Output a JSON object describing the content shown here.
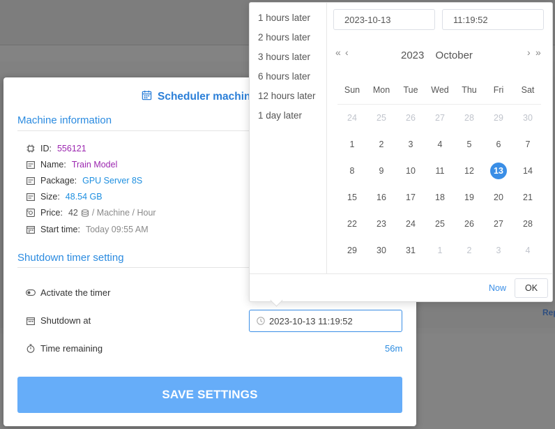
{
  "modal": {
    "title": "Scheduler machin",
    "machine_section": "Machine information",
    "machine": {
      "id_label": "ID:",
      "id_value": "556121",
      "name_label": "Name:",
      "name_value": "Train Model",
      "package_label": "Package:",
      "package_value": "GPU Server 8S",
      "size_label": "Size:",
      "size_value": "48.54 GB",
      "price_label": "Price:",
      "price_value": "42",
      "price_unit": "/ Machine / Hour",
      "start_label": "Start time:",
      "start_value": "Today 09:55 AM"
    },
    "timer_section": "Shutdown timer setting",
    "activate_label": "Activate the timer",
    "shutdown_label": "Shutdown at",
    "shutdown_value": "2023-10-13 11:19:52",
    "remaining_label": "Time remaining",
    "remaining_value": "56m",
    "save_label": "SAVE SETTINGS"
  },
  "background": {
    "link_text": "Rep"
  },
  "picker": {
    "shortcuts": [
      "1 hours later",
      "2 hours later",
      "3 hours later",
      "6 hours later",
      "12 hours later",
      "1 day later"
    ],
    "date_value": "2023-10-13",
    "time_value": "11:19:52",
    "year": "2023",
    "month": "October",
    "prev_year": "«",
    "prev_month": "‹",
    "next_month": "›",
    "next_year": "»",
    "weekdays": [
      "Sun",
      "Mon",
      "Tue",
      "Wed",
      "Thu",
      "Fri",
      "Sat"
    ],
    "weeks": [
      [
        "24",
        "25",
        "26",
        "27",
        "28",
        "29",
        "30"
      ],
      [
        "1",
        "2",
        "3",
        "4",
        "5",
        "6",
        "7"
      ],
      [
        "8",
        "9",
        "10",
        "11",
        "12",
        "13",
        "14"
      ],
      [
        "15",
        "16",
        "17",
        "18",
        "19",
        "20",
        "21"
      ],
      [
        "22",
        "23",
        "24",
        "25",
        "26",
        "27",
        "28"
      ],
      [
        "29",
        "30",
        "31",
        "1",
        "2",
        "3",
        "4"
      ]
    ],
    "other_month": [
      [
        true,
        true,
        true,
        true,
        true,
        true,
        true
      ],
      [
        false,
        false,
        false,
        false,
        false,
        false,
        false
      ],
      [
        false,
        false,
        false,
        false,
        false,
        false,
        false
      ],
      [
        false,
        false,
        false,
        false,
        false,
        false,
        false
      ],
      [
        false,
        false,
        false,
        false,
        false,
        false,
        false
      ],
      [
        false,
        false,
        false,
        true,
        true,
        true,
        true
      ]
    ],
    "selected_day": "13",
    "now_label": "Now",
    "ok_label": "OK"
  }
}
